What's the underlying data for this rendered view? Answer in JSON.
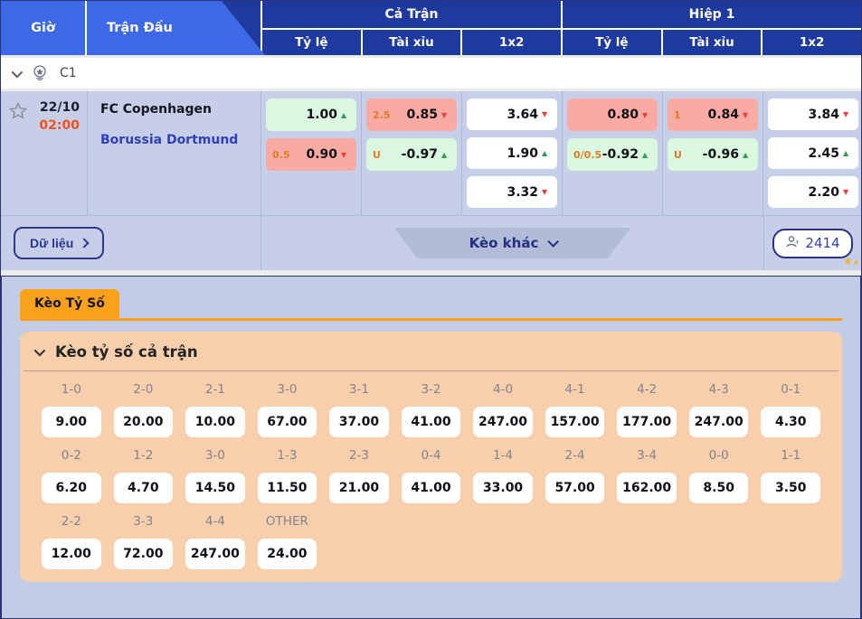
{
  "header": {
    "tabs": {
      "time": "Giờ",
      "match": "Trận Đấu"
    },
    "groups": [
      {
        "label": "Cả Trận",
        "cols": [
          "Tỷ lệ",
          "Tài xỉu",
          "1x2"
        ]
      },
      {
        "label": "Hiệp 1",
        "cols": [
          "Tỷ lệ",
          "Tài xỉu",
          "1x2"
        ]
      }
    ]
  },
  "league": {
    "name": "C1"
  },
  "match": {
    "date": "22/10",
    "time": "02:00",
    "home": "FC Copenhagen",
    "away": "Borussia Dortmund",
    "full": {
      "handicap": [
        {
          "label": "",
          "value": "1.00",
          "trend": "up",
          "tone": "green"
        },
        {
          "label": "0.5",
          "value": "0.90",
          "trend": "down",
          "tone": "red"
        }
      ],
      "ou": [
        {
          "label": "2.5",
          "value": "0.85",
          "trend": "down",
          "tone": "red"
        },
        {
          "label": "U",
          "value": "-0.97",
          "trend": "up",
          "tone": "green"
        }
      ],
      "x12": [
        {
          "value": "3.64",
          "trend": "down"
        },
        {
          "value": "1.90",
          "trend": "up"
        },
        {
          "value": "3.32",
          "trend": "down"
        }
      ]
    },
    "half": {
      "handicap": [
        {
          "label": "",
          "value": "0.80",
          "trend": "down",
          "tone": "red"
        },
        {
          "label": "0/0.5",
          "value": "-0.92",
          "trend": "up",
          "tone": "green"
        }
      ],
      "ou": [
        {
          "label": "1",
          "value": "0.84",
          "trend": "down",
          "tone": "red"
        },
        {
          "label": "U",
          "value": "-0.96",
          "trend": "up",
          "tone": "green"
        }
      ],
      "x12": [
        {
          "value": "3.84",
          "trend": "down"
        },
        {
          "value": "2.45",
          "trend": "up"
        },
        {
          "value": "2.20",
          "trend": "down"
        }
      ]
    }
  },
  "actions": {
    "data_button": "Dữ liệu",
    "more_odds": "Kèo khác",
    "viewers": "2414"
  },
  "score_section": {
    "tab": "Kèo Tỷ Số",
    "panel_title": "Kèo tỷ số cả trận",
    "rows": [
      [
        {
          "score": "1-0",
          "odds": "9.00"
        },
        {
          "score": "2-0",
          "odds": "20.00"
        },
        {
          "score": "2-1",
          "odds": "10.00"
        },
        {
          "score": "3-0",
          "odds": "67.00"
        },
        {
          "score": "3-1",
          "odds": "37.00"
        },
        {
          "score": "3-2",
          "odds": "41.00"
        },
        {
          "score": "4-0",
          "odds": "247.00"
        },
        {
          "score": "4-1",
          "odds": "157.00"
        },
        {
          "score": "4-2",
          "odds": "177.00"
        },
        {
          "score": "4-3",
          "odds": "247.00"
        },
        {
          "score": "0-1",
          "odds": "4.30"
        }
      ],
      [
        {
          "score": "0-2",
          "odds": "6.20"
        },
        {
          "score": "1-2",
          "odds": "4.70"
        },
        {
          "score": "3-0",
          "odds": "14.50"
        },
        {
          "score": "1-3",
          "odds": "11.50"
        },
        {
          "score": "2-3",
          "odds": "21.00"
        },
        {
          "score": "0-4",
          "odds": "41.00"
        },
        {
          "score": "1-4",
          "odds": "33.00"
        },
        {
          "score": "2-4",
          "odds": "57.00"
        },
        {
          "score": "3-4",
          "odds": "162.00"
        },
        {
          "score": "0-0",
          "odds": "8.50"
        },
        {
          "score": "1-1",
          "odds": "3.50"
        }
      ],
      [
        {
          "score": "2-2",
          "odds": "12.00"
        },
        {
          "score": "3-3",
          "odds": "72.00"
        },
        {
          "score": "4-4",
          "odds": "247.00"
        },
        {
          "score": "OTHER",
          "odds": "24.00"
        }
      ]
    ]
  },
  "icons": {
    "favorite": "star-outline",
    "expand": "chevron-down",
    "forward": "chevron-right",
    "viewers": "person",
    "league": "trophy-ball",
    "sparkle": "gold-stars"
  },
  "colors": {
    "tab_blue": "#3d68e6",
    "header_navy": "#1e3a9e",
    "row_lavender": "#c6cee8",
    "cell_green": "#d9f8df",
    "cell_red": "#f9aba3",
    "trend_up": "#2e9e53",
    "trend_down": "#e8413c",
    "handicap_label": "#e07b28",
    "time_orange": "#f4511e",
    "away_blue": "#2f3fbe",
    "accent_orange": "#f9a11b",
    "panel_peach": "#f8cfad",
    "navy_text": "#2b3790"
  }
}
